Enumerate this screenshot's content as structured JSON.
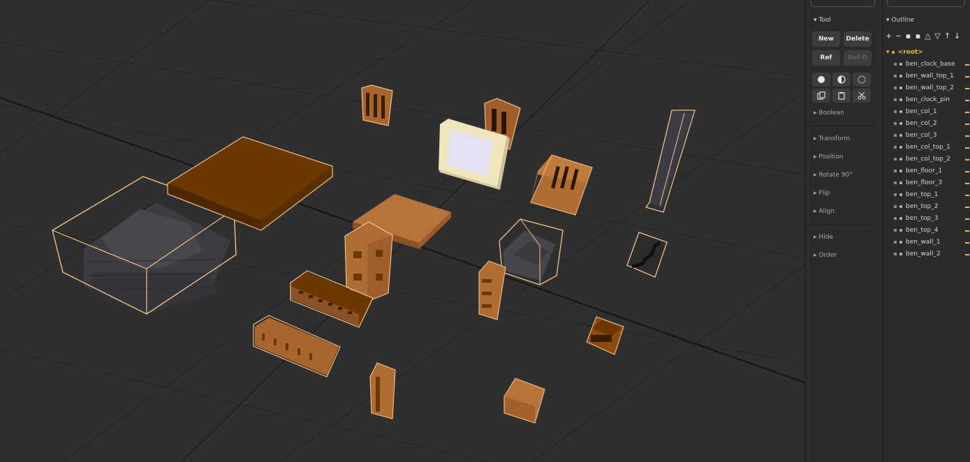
{
  "tool_panel": {
    "title": "Tool",
    "buttons": {
      "new": "New",
      "delete": "Delete",
      "ref": "Ref",
      "ref_d": "Ref-D"
    },
    "icon_buttons": [
      "solid-sphere-icon",
      "half-sphere-icon",
      "hollow-sphere-icon",
      "copy-icon",
      "paste-icon",
      "scissors-icon"
    ],
    "sections": [
      "Boolean",
      "Transform",
      "Position",
      "Rotate 90°",
      "Flip",
      "Align",
      "Hide",
      "Order"
    ]
  },
  "outline_panel": {
    "title": "Outline",
    "toolbar": [
      "+",
      "−",
      "▪︎",
      "▪︎",
      "△",
      "▽",
      "↑",
      "↓"
    ],
    "root_label": "<root>",
    "items": [
      "ben_clock_base",
      "ben_wall_top_1",
      "ben_wall_top_2",
      "ben_clock_pin",
      "ben_col_1",
      "ben_col_2",
      "ben_col_3",
      "ben_col_top_1",
      "ben_col_top_2",
      "ben_floor_1",
      "ben_floor_3",
      "ben_top_1",
      "ben_top_2",
      "ben_top_3",
      "ben_top_4",
      "ben_wall_1",
      "ben_wall_2"
    ]
  },
  "colors": {
    "viewport_bg": "#2f2f2f",
    "panel_bg": "#2b2b2b",
    "selection_outline": "#f2c08a",
    "wood_dark": "#6b3800",
    "wood_light": "#b8733a",
    "stone": "#3b3a40",
    "root_accent": "#f2b33d"
  }
}
